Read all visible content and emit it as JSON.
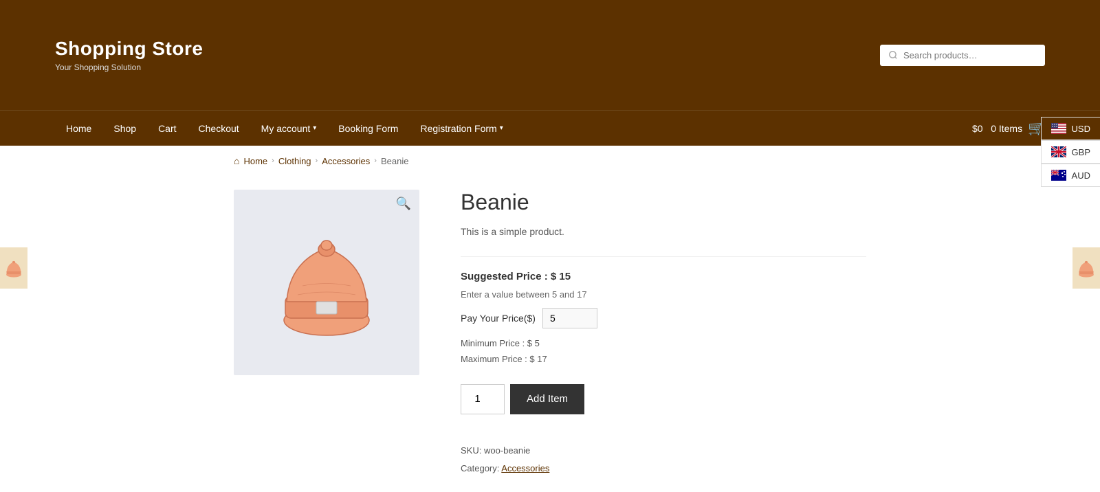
{
  "header": {
    "store_name": "Shopping Store",
    "store_tagline": "Your Shopping Solution",
    "search_placeholder": "Search products…"
  },
  "nav": {
    "items": [
      {
        "label": "Home",
        "has_dropdown": false
      },
      {
        "label": "Shop",
        "has_dropdown": false
      },
      {
        "label": "Cart",
        "has_dropdown": false
      },
      {
        "label": "Checkout",
        "has_dropdown": false
      },
      {
        "label": "My account",
        "has_dropdown": true
      },
      {
        "label": "Booking Form",
        "has_dropdown": false
      },
      {
        "label": "Registration Form",
        "has_dropdown": true
      }
    ],
    "cart_price": "$0",
    "cart_items": "0 Items"
  },
  "breadcrumb": {
    "home": "Home",
    "clothing": "Clothing",
    "accessories": "Accessories",
    "current": "Beanie"
  },
  "product": {
    "title": "Beanie",
    "description": "This is a simple product.",
    "suggested_price_label": "Suggested Price : $ 15",
    "price_note": "Enter a value between 5 and 17",
    "pay_label": "Pay Your Price($)",
    "pay_value": "5",
    "min_price": "Minimum Price : $ 5",
    "max_price": "Maximum Price : $ 17",
    "qty_value": "1",
    "add_item_label": "Add Item",
    "sku_label": "SKU:",
    "sku_value": "woo-beanie",
    "category_label": "Category:",
    "category_value": "Accessories"
  },
  "currencies": [
    {
      "code": "USD",
      "active": true
    },
    {
      "code": "GBP",
      "active": false
    },
    {
      "code": "AUD",
      "active": false
    }
  ]
}
